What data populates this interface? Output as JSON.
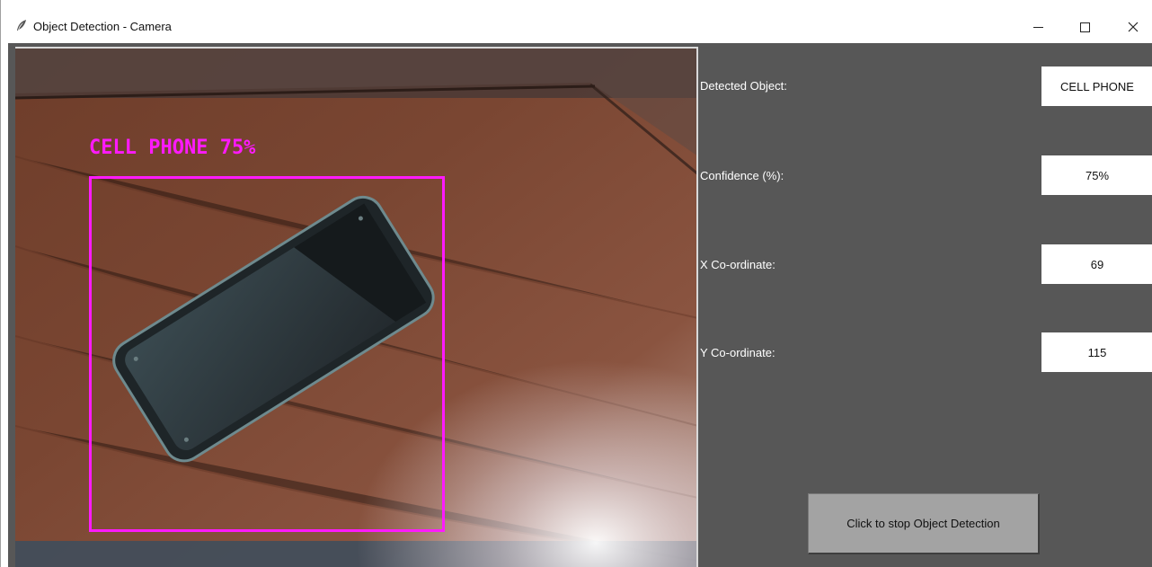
{
  "window": {
    "title": "Object Detection - Camera",
    "icon": "feather-icon"
  },
  "camera": {
    "overlay_label": "CELL PHONE 75%",
    "overlay_color": "#ff1aff"
  },
  "fields": [
    {
      "label": "Detected Object:",
      "value": "CELL PHONE"
    },
    {
      "label": "Confidence (%):",
      "value": "75%"
    },
    {
      "label": "X Co-ordinate:",
      "value": "69"
    },
    {
      "label": "Y Co-ordinate:",
      "value": "115"
    }
  ],
  "stop_button": {
    "label": "Click to stop Object Detection"
  },
  "colors": {
    "panel_bg": "#575757",
    "button_bg": "#a3a3a3",
    "box_color": "#ff1aff"
  }
}
